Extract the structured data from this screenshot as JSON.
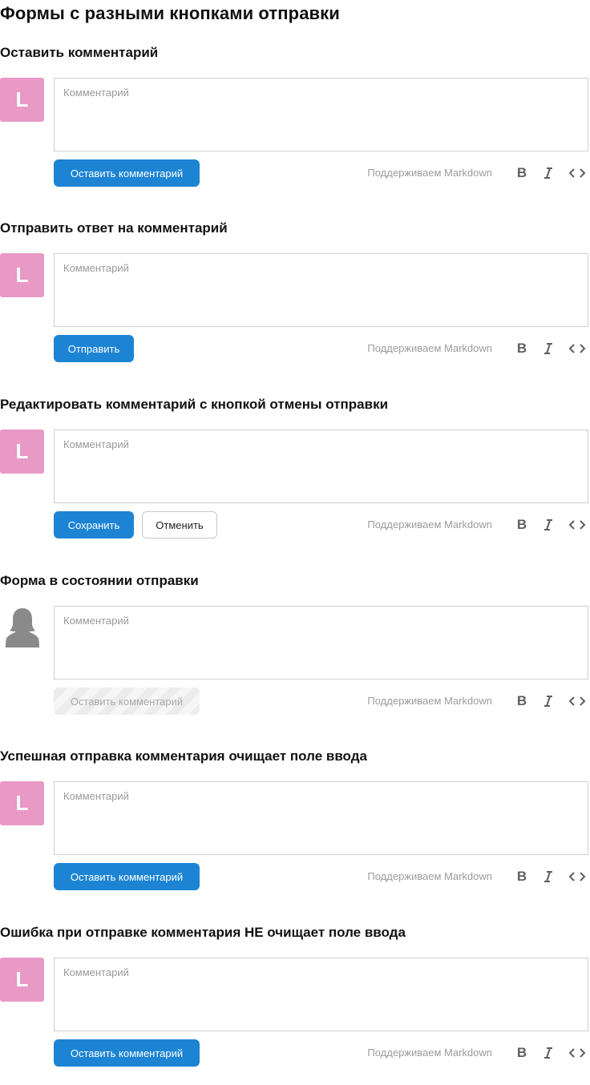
{
  "page": {
    "title": "Формы с разными кнопками отправки"
  },
  "common": {
    "avatar_initial": "L",
    "placeholder": "Комментарий",
    "markdown_hint": "Поддерживаем Markdown",
    "bold_label": "B"
  },
  "sections": [
    {
      "heading": "Оставить комментарий",
      "submit_label": "Оставить комментарий"
    },
    {
      "heading": "Отправить ответ на комментарий",
      "submit_label": "Отправить"
    },
    {
      "heading": "Редактировать комментарий с кнопкой отмены отправки",
      "submit_label": "Сохранить",
      "cancel_label": "Отменить"
    },
    {
      "heading": "Форма в состоянии отправки",
      "submit_label": "Оставить комментарий",
      "state": "submitting",
      "avatar": "default-user-icon"
    },
    {
      "heading": "Успешная отправка комментария очищает поле ввода",
      "submit_label": "Оставить комментарий"
    },
    {
      "heading": "Ошибка при отправке комментария НЕ очищает поле ввода",
      "submit_label": "Оставить комментарий"
    }
  ],
  "colors": {
    "primary": "#1d84d4",
    "avatar_bg": "#e899c6",
    "border": "#cfcfcf",
    "hint_text": "#9c9c9c"
  }
}
